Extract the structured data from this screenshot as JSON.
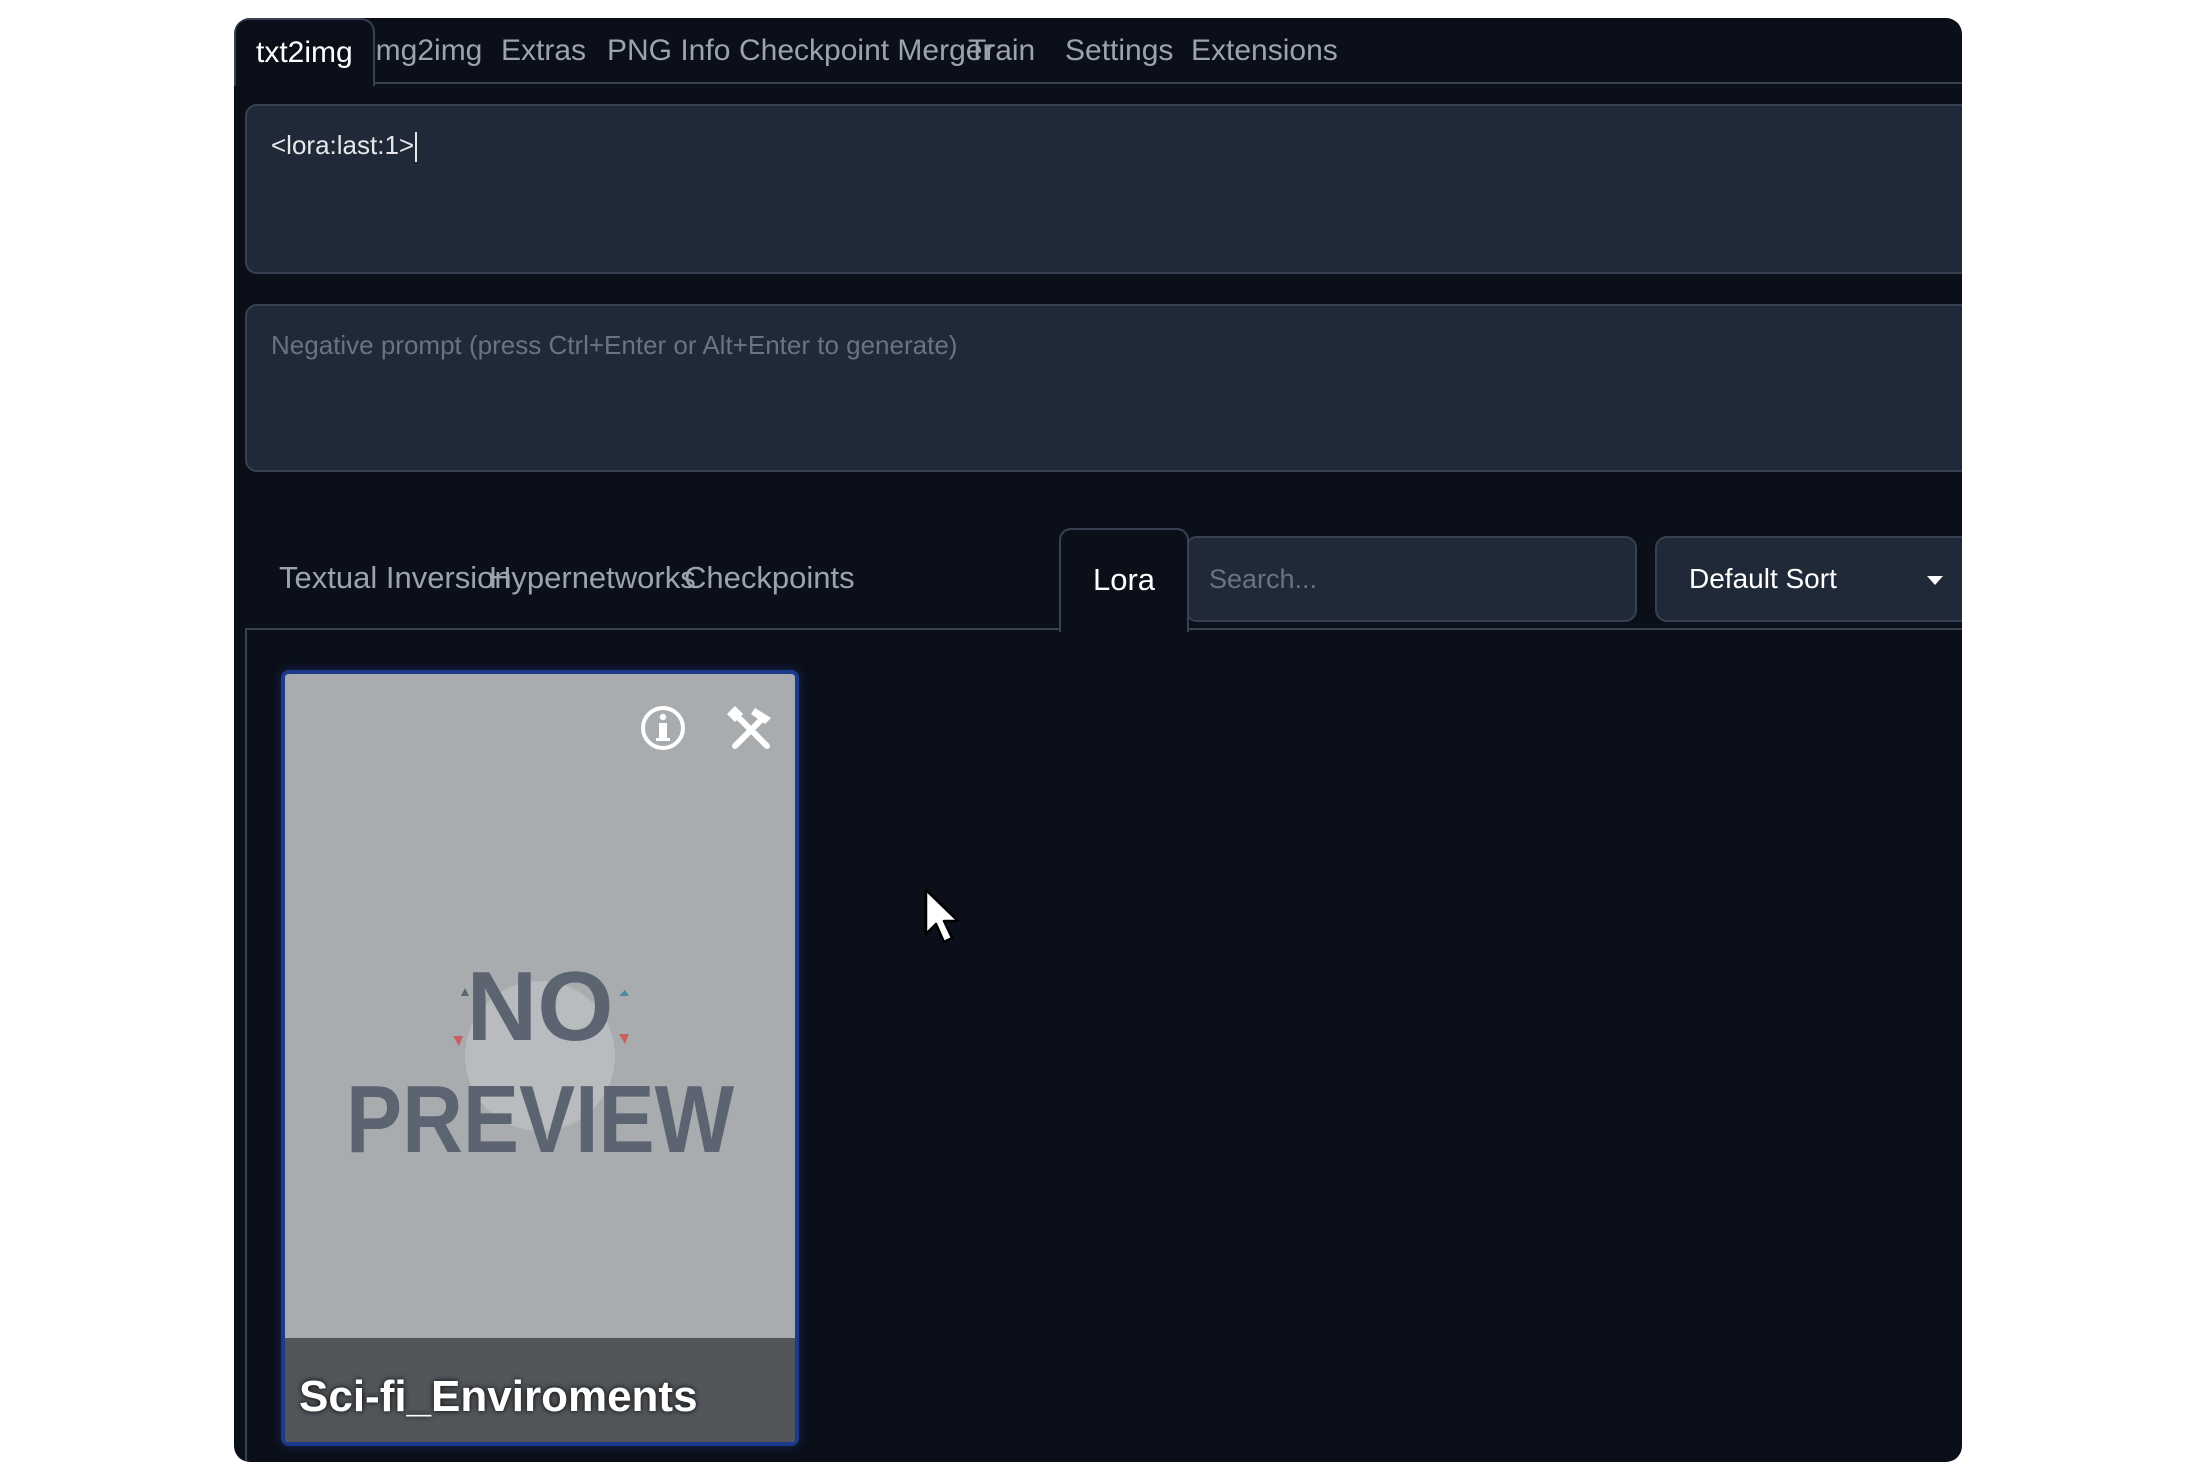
{
  "top_tabs": [
    {
      "label": "txt2img",
      "active": true
    },
    {
      "label": "img2img"
    },
    {
      "label": "Extras"
    },
    {
      "label": "PNG Info"
    },
    {
      "label": "Checkpoint Merger"
    },
    {
      "label": "Train"
    },
    {
      "label": "Settings"
    },
    {
      "label": "Extensions"
    }
  ],
  "prompt": {
    "value": "<lora:last:1>"
  },
  "negative_prompt": {
    "placeholder": "Negative prompt (press Ctrl+Enter or Alt+Enter to generate)"
  },
  "extra_networks": {
    "tabs": [
      {
        "label": "Textual Inversion"
      },
      {
        "label": "Hypernetworks"
      },
      {
        "label": "Checkpoints"
      },
      {
        "label": "Lora",
        "active": true
      }
    ],
    "search_placeholder": "Search...",
    "sort_value": "Default Sort"
  },
  "cards": [
    {
      "name": "Sci-fi_Enviroments",
      "preview_text_1": "NO",
      "preview_text_2": "PREVIEW",
      "info_icon": "info-icon",
      "tools_icon": "tools-icon"
    }
  ],
  "colors": {
    "background": "#0b0f19",
    "panel": "#1f2937",
    "border": "#374151",
    "card_border": "#1e3a8a"
  }
}
